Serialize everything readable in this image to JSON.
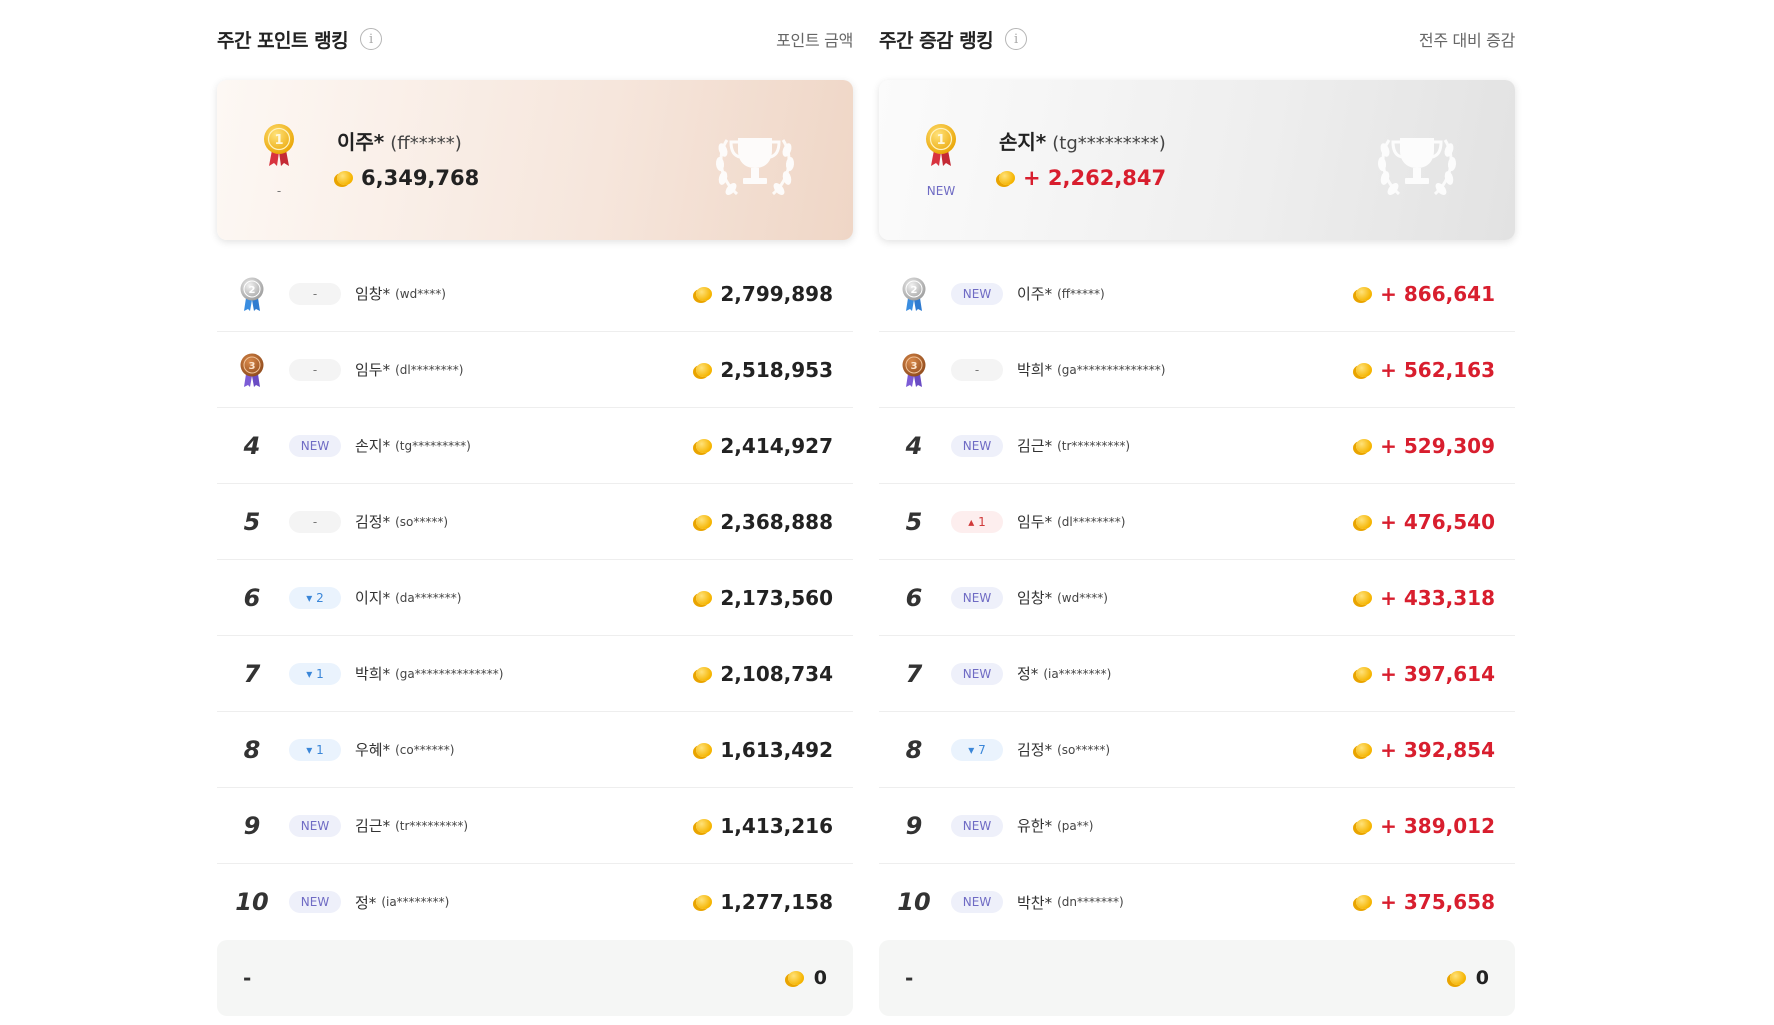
{
  "left": {
    "title": "주간 포인트 랭킹",
    "subtitle": "포인트 금액",
    "top": {
      "name": "이주*",
      "id": "(ff*****)",
      "status": "-",
      "points": "6,349,768"
    },
    "rows": [
      {
        "rank": "2",
        "status": "-",
        "name": "임창*",
        "id": "(wd****)",
        "points": "2,799,898"
      },
      {
        "rank": "3",
        "status": "-",
        "name": "임두*",
        "id": "(dl********)",
        "points": "2,518,953"
      },
      {
        "rank": "4",
        "status": "NEW",
        "name": "손지*",
        "id": "(tg*********)",
        "points": "2,414,927"
      },
      {
        "rank": "5",
        "status": "-",
        "name": "김정*",
        "id": "(so*****)",
        "points": "2,368,888"
      },
      {
        "rank": "6",
        "status": "▾ 2",
        "name": "이지*",
        "id": "(da*******)",
        "points": "2,173,560"
      },
      {
        "rank": "7",
        "status": "▾ 1",
        "name": "박희*",
        "id": "(ga**************)",
        "points": "2,108,734"
      },
      {
        "rank": "8",
        "status": "▾ 1",
        "name": "우혜*",
        "id": "(co******)",
        "points": "1,613,492"
      },
      {
        "rank": "9",
        "status": "NEW",
        "name": "김근*",
        "id": "(tr*********)",
        "points": "1,413,216"
      },
      {
        "rank": "10",
        "status": "NEW",
        "name": "정*",
        "id": "(ia********)",
        "points": "1,277,158"
      }
    ],
    "my": {
      "rank": "-",
      "points": "0"
    }
  },
  "right": {
    "title": "주간 증감 랭킹",
    "subtitle": "전주 대비 증감",
    "top": {
      "name": "손지*",
      "id": "(tg*********)",
      "status": "NEW",
      "points": "+ 2,262,847"
    },
    "rows": [
      {
        "rank": "2",
        "status": "NEW",
        "name": "이주*",
        "id": "(ff*****)",
        "points": "+ 866,641"
      },
      {
        "rank": "3",
        "status": "-",
        "name": "박희*",
        "id": "(ga**************)",
        "points": "+ 562,163"
      },
      {
        "rank": "4",
        "status": "NEW",
        "name": "김근*",
        "id": "(tr*********)",
        "points": "+ 529,309"
      },
      {
        "rank": "5",
        "status": "▴ 1",
        "name": "임두*",
        "id": "(dl********)",
        "points": "+ 476,540"
      },
      {
        "rank": "6",
        "status": "NEW",
        "name": "임창*",
        "id": "(wd****)",
        "points": "+ 433,318"
      },
      {
        "rank": "7",
        "status": "NEW",
        "name": "정*",
        "id": "(ia********)",
        "points": "+ 397,614"
      },
      {
        "rank": "8",
        "status": "▾ 7",
        "name": "김정*",
        "id": "(so*****)",
        "points": "+ 392,854"
      },
      {
        "rank": "9",
        "status": "NEW",
        "name": "유한*",
        "id": "(pa**)",
        "points": "+ 389,012"
      },
      {
        "rank": "10",
        "status": "NEW",
        "name": "박찬*",
        "id": "(dn*******)",
        "points": "+ 375,658"
      }
    ],
    "my": {
      "rank": "-",
      "points": "0"
    }
  },
  "icons": {
    "info": "info-icon",
    "coin": "coin-icon",
    "trophy": "trophy-icon",
    "medal_gold": "gold-medal-icon",
    "medal_silver": "silver-medal-icon",
    "medal_bronze": "bronze-medal-icon"
  },
  "colors": {
    "increase_red": "#d81e2e",
    "new_badge": "#6f6bc4",
    "down_badge": "#3a86d8",
    "up_badge": "#d03a3a",
    "coin_gold": "#f5b400"
  }
}
